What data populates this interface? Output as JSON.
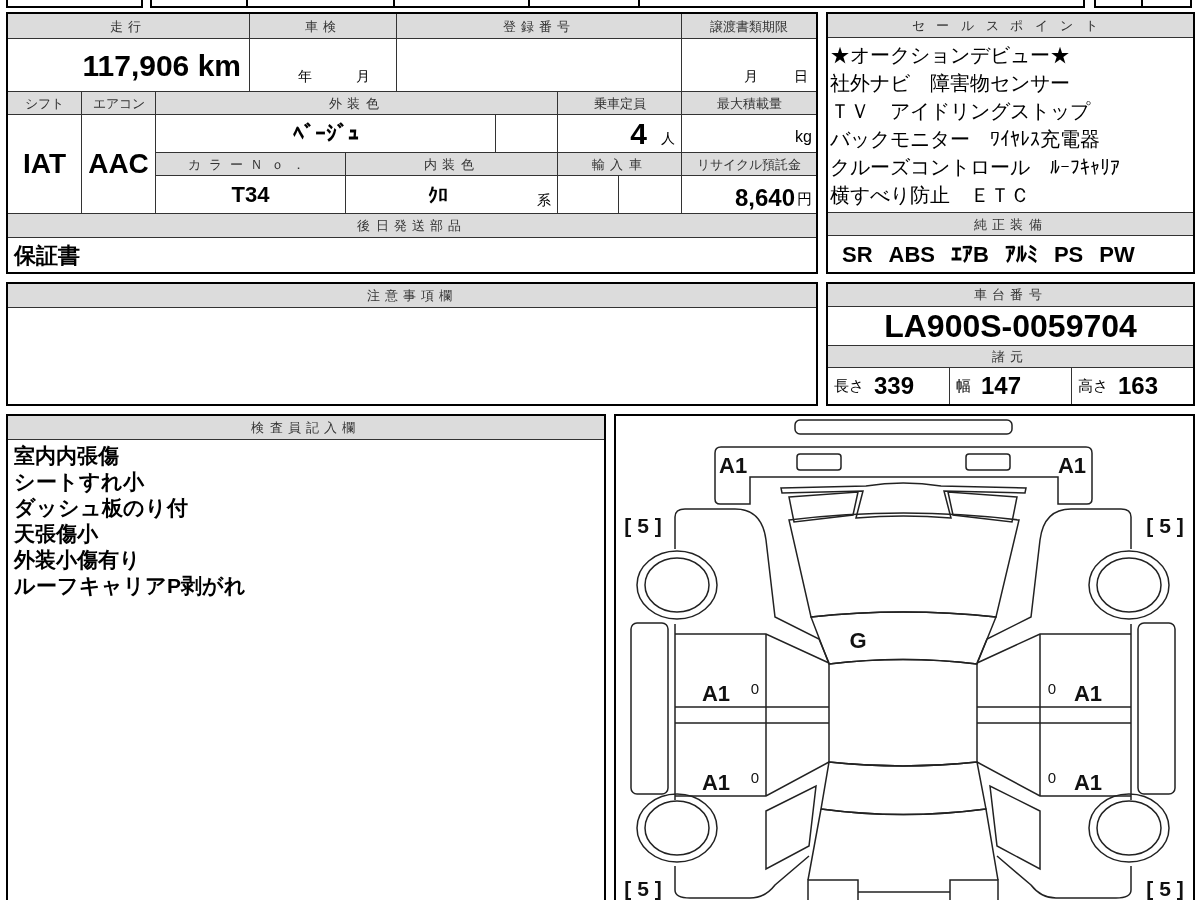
{
  "vehicle_info": {
    "mileage": {
      "label": "走行",
      "value": "117,906 km"
    },
    "inspection": {
      "label": "車検",
      "year_unit": "年",
      "month_unit": "月"
    },
    "registration_number": {
      "label": "登録番号"
    },
    "transfer_deadline": {
      "label": "譲渡書類期限",
      "month_unit": "月",
      "day_unit": "日"
    },
    "shift": {
      "label": "シフト",
      "value": "IAT"
    },
    "air_conditioner": {
      "label": "エアコン",
      "value": "AAC"
    },
    "exterior_color": {
      "label": "外装色",
      "value": "ﾍﾞｰｼﾞｭ"
    },
    "capacity": {
      "label": "乗車定員",
      "value": "4",
      "unit": "人"
    },
    "max_load": {
      "label": "最大積載量",
      "unit": "kg"
    },
    "color_number": {
      "label": "カラーＮｏ．",
      "value": "T34"
    },
    "interior_color": {
      "label": "内装色",
      "value": "ｸﾛ",
      "suffix": "系"
    },
    "imported": {
      "label": "輸入車"
    },
    "recycling_deposit": {
      "label": "リサイクル預託金",
      "value": "8,640",
      "unit": "円"
    },
    "later_shipped_parts": {
      "label": "後日発送部品",
      "value": "保証書"
    }
  },
  "sales_points": {
    "label": "セールスポイント",
    "lines": [
      "★オークションデビュー★",
      "社外ナビ　障害物センサー",
      "ＴＶ　アイドリングストップ",
      "バックモニター　ﾜｲﾔﾚｽ充電器",
      "クルーズコントロール　ﾙｰﾌｷｬﾘｱ",
      "横すべり防止　ＥＴＣ"
    ]
  },
  "standard_equipment": {
    "label": "純正装備",
    "items": [
      "SR",
      "ABS",
      "ｴｱB",
      "ｱﾙﾐ",
      "PS",
      "PW"
    ]
  },
  "notes": {
    "label": "注意事項欄"
  },
  "chassis": {
    "label": "車台番号",
    "value": "LA900S-0059704"
  },
  "specifications": {
    "label": "諸元",
    "items": [
      {
        "label": "長さ",
        "value": "339"
      },
      {
        "label": "幅",
        "value": "147"
      },
      {
        "label": "高さ",
        "value": "163"
      }
    ]
  },
  "inspector_remarks": {
    "label": "検査員記入欄",
    "lines": [
      "室内内張傷",
      "シートすれ小",
      "ダッシュ板のり付",
      "天張傷小",
      "外装小傷有り",
      "ルーフキャリアP剥がれ"
    ]
  },
  "damage_diagram": {
    "front_bumper_left": {
      "grade": "A1"
    },
    "front_bumper_right": {
      "grade": "A1"
    },
    "tire_front_left": {
      "tread": "[ 5 ]"
    },
    "tire_front_right": {
      "tread": "[ 5 ]"
    },
    "windshield": {
      "grade": "G"
    },
    "front_left_door": {
      "grade": "A1",
      "note": "0"
    },
    "front_right_door": {
      "note": "0",
      "grade": "A1"
    },
    "rear_left_door": {
      "grade": "A1",
      "note": "0"
    },
    "rear_right_door": {
      "note": "0",
      "grade": "A1"
    },
    "tire_rear_left": {
      "tread": "[ 5 ]"
    },
    "tire_rear_right": {
      "tread": "[ 5 ]"
    }
  }
}
